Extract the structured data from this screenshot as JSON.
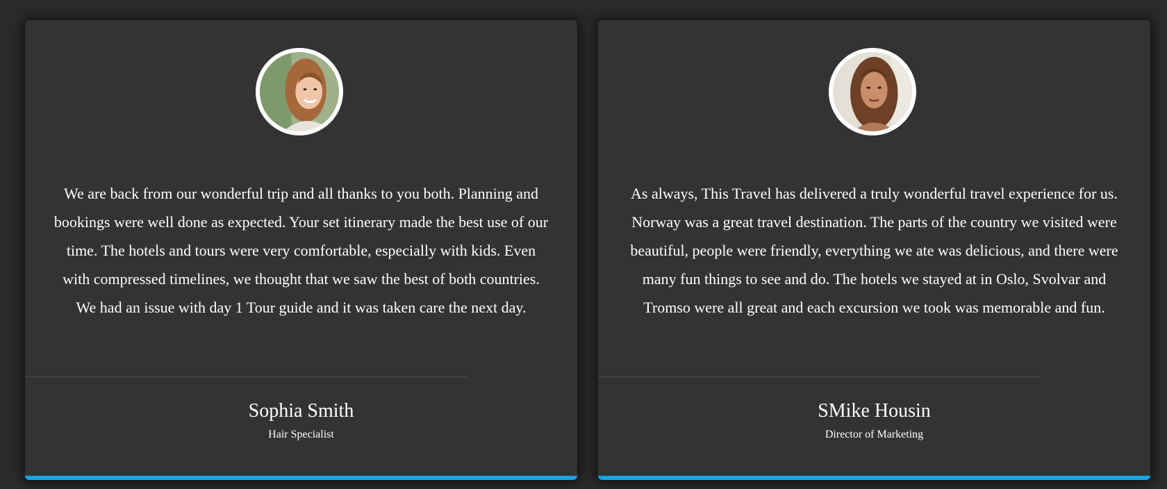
{
  "accent_color": "#1aa3e8",
  "testimonials": [
    {
      "avatar_icon": "woman-portrait-photo",
      "quote": "We are back from our wonderful trip and all thanks to you both. Planning and bookings were well done as expected. Your set itinerary made the best use of our time. The hotels and tours were very comfortable, especially with kids. Even with compressed timelines, we thought that we saw the best of both countries. We had an issue with day 1 Tour guide and it was taken care the next day.",
      "name": "Sophia Smith",
      "role": "Hair Specialist"
    },
    {
      "avatar_icon": "woman-portrait-photo",
      "quote": "As always, This Travel has delivered a truly wonderful travel experience for us. Norway was a great travel destination. The parts of the country we visited were beautiful, people were friendly, everything we ate was delicious, and there were many fun things to see and do. The hotels we stayed at in Oslo, Svolvar and Tromso were all great and each excursion we took was memorable and fun.",
      "name": "SMike Housin",
      "role": "Director of Marketing"
    }
  ]
}
